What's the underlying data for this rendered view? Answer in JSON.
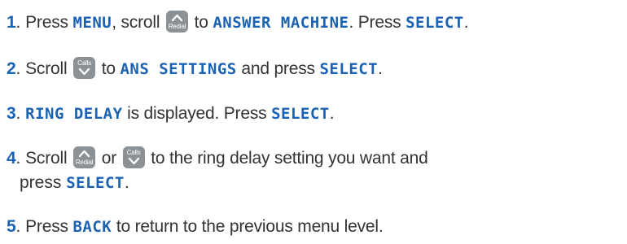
{
  "steps": [
    {
      "number": "1",
      "parts": {
        "a": "Press ",
        "b": "MENU",
        "c": ", scroll ",
        "d": " to ",
        "e": "ANSWER MACHINE",
        "f": ". Press ",
        "g": "SELECT",
        "h": "."
      }
    },
    {
      "number": "2",
      "parts": {
        "a": "Scroll ",
        "b": " to ",
        "c": "ANS SETTINGS",
        "d": " and press ",
        "e": "SELECT",
        "f": "."
      }
    },
    {
      "number": "3",
      "parts": {
        "a": "RING DELAY",
        "b": " is displayed. Press ",
        "c": "SELECT",
        "d": "."
      }
    },
    {
      "number": "4",
      "parts": {
        "a": "Scroll ",
        "b": " or ",
        "c": " to the ring delay setting you want and",
        "d": "press ",
        "e": "SELECT",
        "f": "."
      }
    },
    {
      "number": "5",
      "parts": {
        "a": "Press ",
        "b": "BACK",
        "c": " to return to the previous menu level."
      }
    }
  ],
  "keys": {
    "redial_label": "Redial",
    "calls_label": "Calls"
  },
  "colors": {
    "accent": "#1b63b2",
    "text": "#333333",
    "key_bg": "#8c9196"
  }
}
